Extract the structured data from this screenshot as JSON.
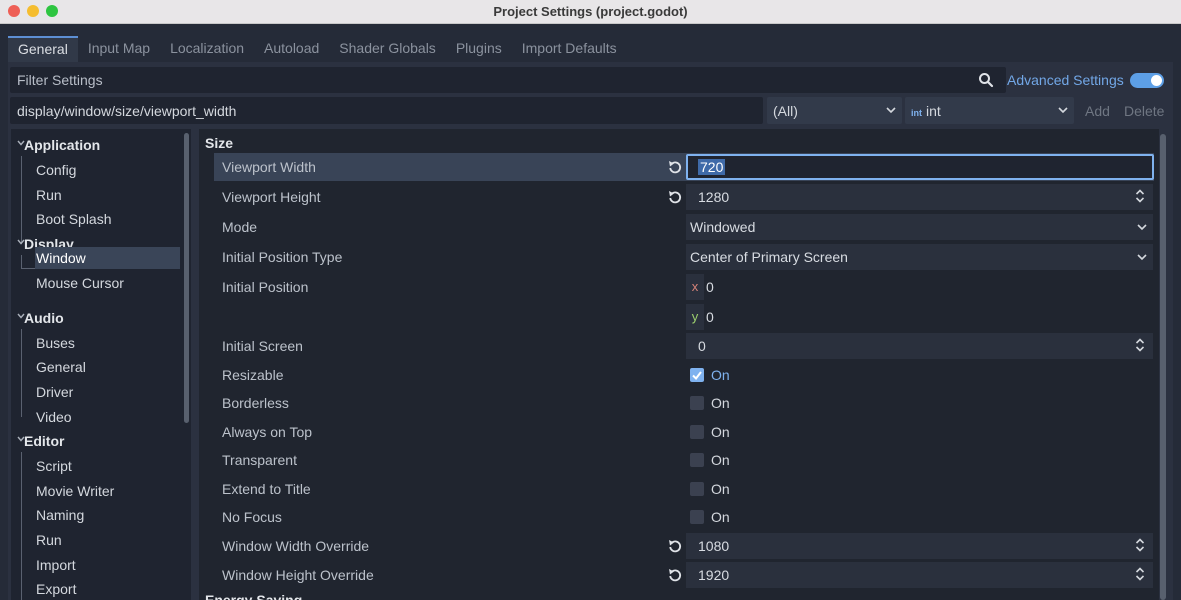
{
  "window": {
    "title": "Project Settings (project.godot)"
  },
  "tabs": [
    "General",
    "Input Map",
    "Localization",
    "Autoload",
    "Shader Globals",
    "Plugins",
    "Import Defaults"
  ],
  "filter": {
    "placeholder": "Filter Settings",
    "advanced_label": "Advanced Settings",
    "advanced_enabled": true
  },
  "path": {
    "value": "display/window/size/viewport_width"
  },
  "type_filter": {
    "all": "(All)",
    "type_icon": "int",
    "type": "int"
  },
  "buttons": {
    "add": "Add",
    "delete": "Delete"
  },
  "tree": {
    "application": "Application",
    "config": "Config",
    "run": "Run",
    "boot_splash": "Boot Splash",
    "display": "Display",
    "window": "Window",
    "mouse_cursor": "Mouse Cursor",
    "audio": "Audio",
    "buses": "Buses",
    "general": "General",
    "driver": "Driver",
    "video": "Video",
    "editor": "Editor",
    "script": "Script",
    "movie_writer": "Movie Writer",
    "naming": "Naming",
    "run2": "Run",
    "import": "Import",
    "export": "Export"
  },
  "inspector": {
    "section_size": "Size",
    "section_energy": "Energy Saving",
    "viewport_width": {
      "label": "Viewport Width",
      "value": "720"
    },
    "viewport_height": {
      "label": "Viewport Height",
      "value": "1280"
    },
    "mode": {
      "label": "Mode",
      "value": "Windowed"
    },
    "initial_position_type": {
      "label": "Initial Position Type",
      "value": "Center of Primary Screen"
    },
    "initial_position": {
      "label": "Initial Position",
      "x_axis": "x",
      "x": "0",
      "y_axis": "y",
      "y": "0"
    },
    "initial_screen": {
      "label": "Initial Screen",
      "value": "0"
    },
    "resizable": {
      "label": "Resizable",
      "value": "On",
      "checked": true
    },
    "borderless": {
      "label": "Borderless",
      "value": "On",
      "checked": false
    },
    "always_on_top": {
      "label": "Always on Top",
      "value": "On",
      "checked": false
    },
    "transparent": {
      "label": "Transparent",
      "value": "On",
      "checked": false
    },
    "extend_to_title": {
      "label": "Extend to Title",
      "value": "On",
      "checked": false
    },
    "no_focus": {
      "label": "No Focus",
      "value": "On",
      "checked": false
    },
    "window_width_override": {
      "label": "Window Width Override",
      "value": "1080"
    },
    "window_height_override": {
      "label": "Window Height Override",
      "value": "1920"
    }
  },
  "colors": {
    "accent": "#7fb2ef",
    "highlight_row": "#394457",
    "selected_tree": "#3a4558"
  }
}
